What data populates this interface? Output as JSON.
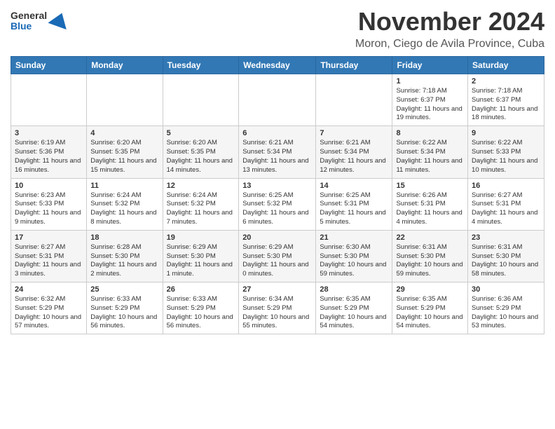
{
  "header": {
    "logo": {
      "line1": "General",
      "line2": "Blue"
    },
    "title": "November 2024",
    "location": "Moron, Ciego de Avila Province, Cuba"
  },
  "days_of_week": [
    "Sunday",
    "Monday",
    "Tuesday",
    "Wednesday",
    "Thursday",
    "Friday",
    "Saturday"
  ],
  "weeks": [
    [
      {
        "day": "",
        "info": ""
      },
      {
        "day": "",
        "info": ""
      },
      {
        "day": "",
        "info": ""
      },
      {
        "day": "",
        "info": ""
      },
      {
        "day": "",
        "info": ""
      },
      {
        "day": "1",
        "info": "Sunrise: 7:18 AM\nSunset: 6:37 PM\nDaylight: 11 hours and 19 minutes."
      },
      {
        "day": "2",
        "info": "Sunrise: 7:18 AM\nSunset: 6:37 PM\nDaylight: 11 hours and 18 minutes."
      }
    ],
    [
      {
        "day": "3",
        "info": "Sunrise: 6:19 AM\nSunset: 5:36 PM\nDaylight: 11 hours and 16 minutes."
      },
      {
        "day": "4",
        "info": "Sunrise: 6:20 AM\nSunset: 5:35 PM\nDaylight: 11 hours and 15 minutes."
      },
      {
        "day": "5",
        "info": "Sunrise: 6:20 AM\nSunset: 5:35 PM\nDaylight: 11 hours and 14 minutes."
      },
      {
        "day": "6",
        "info": "Sunrise: 6:21 AM\nSunset: 5:34 PM\nDaylight: 11 hours and 13 minutes."
      },
      {
        "day": "7",
        "info": "Sunrise: 6:21 AM\nSunset: 5:34 PM\nDaylight: 11 hours and 12 minutes."
      },
      {
        "day": "8",
        "info": "Sunrise: 6:22 AM\nSunset: 5:34 PM\nDaylight: 11 hours and 11 minutes."
      },
      {
        "day": "9",
        "info": "Sunrise: 6:22 AM\nSunset: 5:33 PM\nDaylight: 11 hours and 10 minutes."
      }
    ],
    [
      {
        "day": "10",
        "info": "Sunrise: 6:23 AM\nSunset: 5:33 PM\nDaylight: 11 hours and 9 minutes."
      },
      {
        "day": "11",
        "info": "Sunrise: 6:24 AM\nSunset: 5:32 PM\nDaylight: 11 hours and 8 minutes."
      },
      {
        "day": "12",
        "info": "Sunrise: 6:24 AM\nSunset: 5:32 PM\nDaylight: 11 hours and 7 minutes."
      },
      {
        "day": "13",
        "info": "Sunrise: 6:25 AM\nSunset: 5:32 PM\nDaylight: 11 hours and 6 minutes."
      },
      {
        "day": "14",
        "info": "Sunrise: 6:25 AM\nSunset: 5:31 PM\nDaylight: 11 hours and 5 minutes."
      },
      {
        "day": "15",
        "info": "Sunrise: 6:26 AM\nSunset: 5:31 PM\nDaylight: 11 hours and 4 minutes."
      },
      {
        "day": "16",
        "info": "Sunrise: 6:27 AM\nSunset: 5:31 PM\nDaylight: 11 hours and 4 minutes."
      }
    ],
    [
      {
        "day": "17",
        "info": "Sunrise: 6:27 AM\nSunset: 5:31 PM\nDaylight: 11 hours and 3 minutes."
      },
      {
        "day": "18",
        "info": "Sunrise: 6:28 AM\nSunset: 5:30 PM\nDaylight: 11 hours and 2 minutes."
      },
      {
        "day": "19",
        "info": "Sunrise: 6:29 AM\nSunset: 5:30 PM\nDaylight: 11 hours and 1 minute."
      },
      {
        "day": "20",
        "info": "Sunrise: 6:29 AM\nSunset: 5:30 PM\nDaylight: 11 hours and 0 minutes."
      },
      {
        "day": "21",
        "info": "Sunrise: 6:30 AM\nSunset: 5:30 PM\nDaylight: 10 hours and 59 minutes."
      },
      {
        "day": "22",
        "info": "Sunrise: 6:31 AM\nSunset: 5:30 PM\nDaylight: 10 hours and 59 minutes."
      },
      {
        "day": "23",
        "info": "Sunrise: 6:31 AM\nSunset: 5:30 PM\nDaylight: 10 hours and 58 minutes."
      }
    ],
    [
      {
        "day": "24",
        "info": "Sunrise: 6:32 AM\nSunset: 5:29 PM\nDaylight: 10 hours and 57 minutes."
      },
      {
        "day": "25",
        "info": "Sunrise: 6:33 AM\nSunset: 5:29 PM\nDaylight: 10 hours and 56 minutes."
      },
      {
        "day": "26",
        "info": "Sunrise: 6:33 AM\nSunset: 5:29 PM\nDaylight: 10 hours and 56 minutes."
      },
      {
        "day": "27",
        "info": "Sunrise: 6:34 AM\nSunset: 5:29 PM\nDaylight: 10 hours and 55 minutes."
      },
      {
        "day": "28",
        "info": "Sunrise: 6:35 AM\nSunset: 5:29 PM\nDaylight: 10 hours and 54 minutes."
      },
      {
        "day": "29",
        "info": "Sunrise: 6:35 AM\nSunset: 5:29 PM\nDaylight: 10 hours and 54 minutes."
      },
      {
        "day": "30",
        "info": "Sunrise: 6:36 AM\nSunset: 5:29 PM\nDaylight: 10 hours and 53 minutes."
      }
    ]
  ]
}
